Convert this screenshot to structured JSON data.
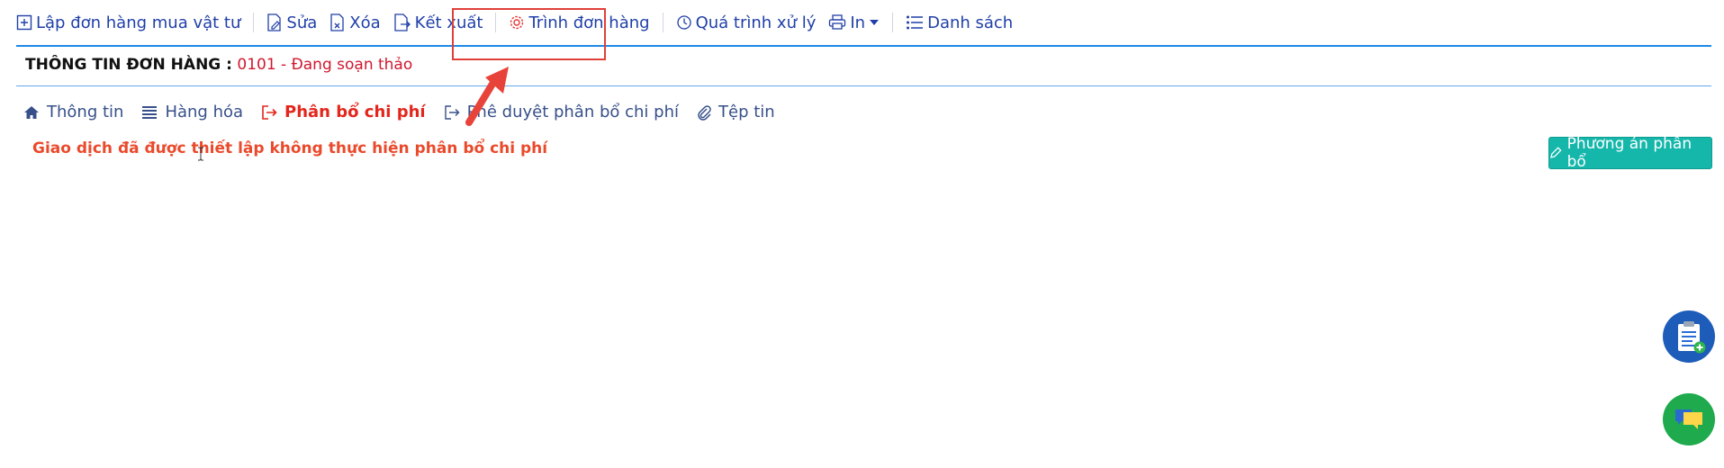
{
  "toolbar": {
    "create_label": "Lập đơn hàng mua vật tư",
    "edit_label": "Sửa",
    "delete_label": "Xóa",
    "export_label": "Kết xuất",
    "submit_label": "Trình đơn hàng",
    "process_label": "Quá trình xử lý",
    "print_label": "In",
    "list_label": "Danh sách"
  },
  "order": {
    "title_label": "THÔNG TIN ĐƠN HÀNG :",
    "status_value": "0101 - Đang soạn thảo"
  },
  "tabs": [
    {
      "label": "Thông tin",
      "icon": "home-icon"
    },
    {
      "label": "Hàng hóa",
      "icon": "list-icon"
    },
    {
      "label": "Phân bổ chi phí",
      "icon": "sign-out-icon",
      "active": true
    },
    {
      "label": "Phê duyệt phân bổ chi phí",
      "icon": "sign-out-icon"
    },
    {
      "label": "Tệp tin",
      "icon": "paperclip-icon"
    }
  ],
  "content": {
    "message": "Giao dịch đã được thiết lập không thực hiện phân bổ chi phí",
    "plan_button_label": "Phương án phân bổ"
  },
  "colors": {
    "link_blue": "#1f3fa8",
    "active_red": "#e3261c",
    "status_red": "#d0182f",
    "teal_button": "#15b7ab",
    "highlight_red": "#e0403a"
  }
}
